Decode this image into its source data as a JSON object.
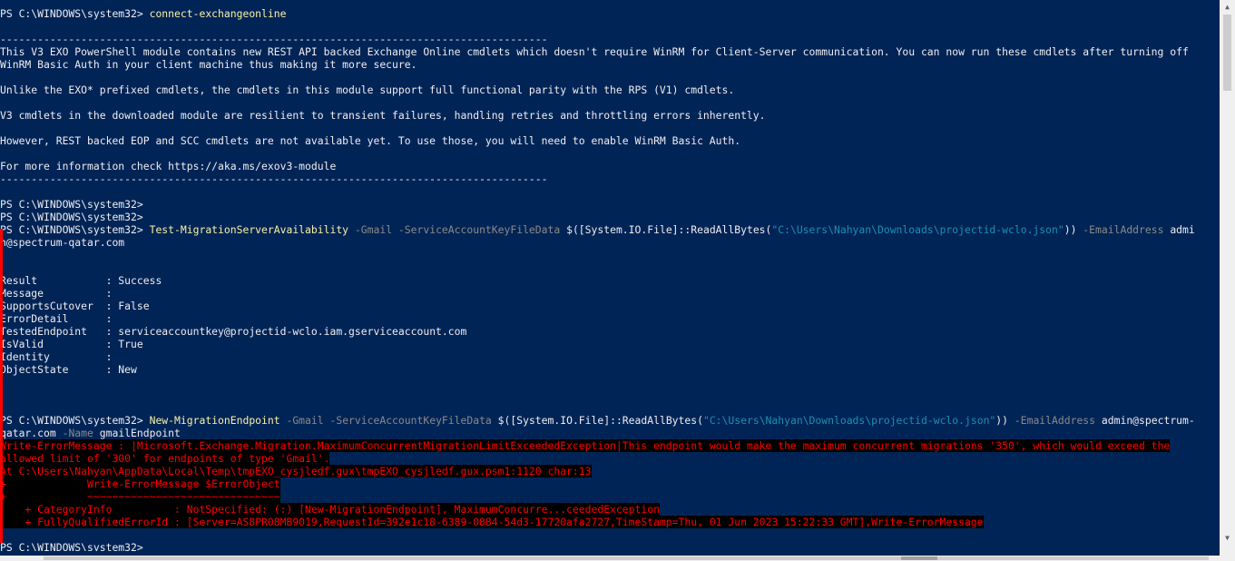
{
  "console": {
    "prompt": "PS C:\\WINDOWS\\system32> ",
    "cmd1": "connect-exchangeonline",
    "banner": {
      "rule": "----------------------------------------------------------------------------------------",
      "p1_l1": "This V3 EXO PowerShell module contains new REST API backed Exchange Online cmdlets which doesn't require WinRM for Client-Server communication. You can now run these cmdlets after turning off",
      "p1_l2": "WinRM Basic Auth in your client machine thus making it more secure.",
      "p2": "Unlike the EXO* prefixed cmdlets, the cmdlets in this module support full functional parity with the RPS (V1) cmdlets.",
      "p3": "V3 cmdlets in the downloaded module are resilient to transient failures, handling retries and throttling errors inherently.",
      "p4": "However, REST backed EOP and SCC cmdlets are not available yet. To use those, you will need to enable WinRM Basic Auth.",
      "p5": "For more information check https://aka.ms/exov3-module"
    },
    "cmd2": {
      "name": "Test-MigrationServerAvailability",
      "p_gmail": " -Gmail",
      "p_keyfile": " -ServiceAccountKeyFileData",
      "expr_start": " $([System.IO.File]::ReadAllBytes(",
      "path": "\"C:\\Users\\Nahyan\\Downloads\\projectid-wclo.json\"",
      "expr_end": "))",
      "p_email": " -EmailAddress",
      "email_l1": " admi",
      "email_l2": "n@spectrum-qatar.com"
    },
    "result": [
      {
        "key": "Result          ",
        "value": " : Success"
      },
      {
        "key": "Message         ",
        "value": " :"
      },
      {
        "key": "SupportsCutover ",
        "value": " : False"
      },
      {
        "key": "ErrorDetail     ",
        "value": " :"
      },
      {
        "key": "TestedEndpoint  ",
        "value": " : serviceaccountkey@projectid-wclo.iam.gserviceaccount.com"
      },
      {
        "key": "IsValid         ",
        "value": " : True"
      },
      {
        "key": "Identity        ",
        "value": " :"
      },
      {
        "key": "ObjectState     ",
        "value": " : New"
      }
    ],
    "cmd3": {
      "name": "New-MigrationEndpoint",
      "p_gmail": " -Gmail",
      "p_keyfile": " -ServiceAccountKeyFileData",
      "expr_start": " $([System.IO.File]::ReadAllBytes(",
      "path": "\"C:\\Users\\Nahyan\\Downloads\\projectid-wclo.json\"",
      "expr_end": "))",
      "p_email": " -EmailAddress",
      "email_l1": " admin@spectrum-",
      "email_l2": "qatar.com",
      "p_name": " -Name",
      "name_val": " gmailEndpoint"
    },
    "error": {
      "l1": "Write-ErrorMessage : |Microsoft.Exchange.Migration.MaximumConcurrentMigrationLimitExceededException|This endpoint would make the maximum concurrent migrations '350', which would exceed the",
      "l2": "allowed limit of '300' for endpoints of type 'Gmail'.",
      "l3": "At C:\\Users\\Nahyan\\AppData\\Local\\Temp\\tmpEXO_cysjledf.gux\\tmpEXO_cysjledf.gux.psm1:1120 char:13",
      "l4": "+             Write-ErrorMessage $ErrorObject",
      "l5": "+             ~~~~~~~~~~~~~~~~~~~~~~~~~~~~~~~",
      "l6": "    + CategoryInfo          : NotSpecified: (:) [New-MigrationEndpoint], MaximumConcurre...ceededException",
      "l7": "    + FullyQualifiedErrorId : [Server=AS8PR08MB9019,RequestId=392e1c18-6389-0884-54d3-17720afa2727,TimeStamp=Thu, 01 Jun 2023 15:22:33 GMT],Write-ErrorMessage"
    }
  },
  "colors": {
    "background": "#012456",
    "foreground": "#eeedf0",
    "command": "#f9f1a5",
    "parameter": "#8a8a8a",
    "string": "#1a8fb3",
    "error_fg": "#ff0000",
    "error_bg": "#000000"
  },
  "icons": {
    "scroll_up": "triangle-up",
    "scroll_down": "triangle-down"
  }
}
